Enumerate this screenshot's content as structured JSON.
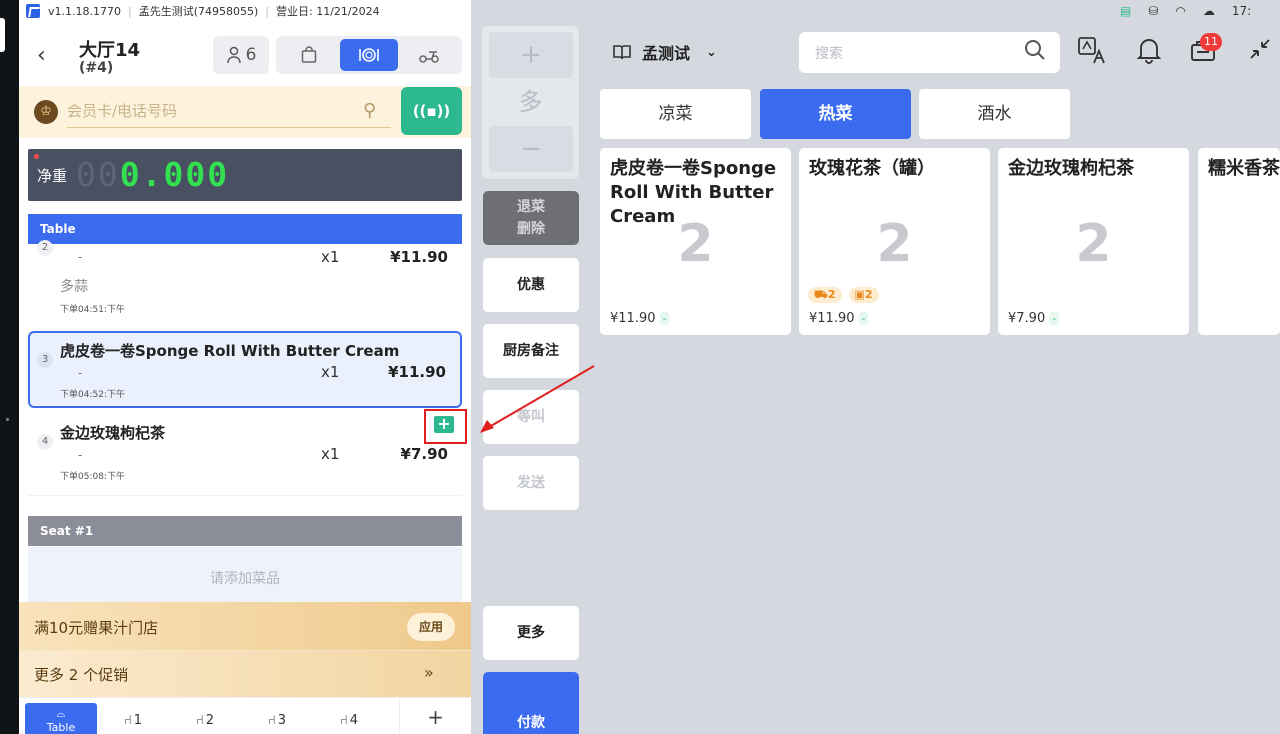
{
  "topbar": {
    "version": "v1.1.18.1770",
    "user": "孟先生测试(74958055)",
    "business_day": "营业日: 11/21/2024"
  },
  "status": {
    "time": "17:"
  },
  "header": {
    "table_name": "大厅14",
    "table_number": "(#4)",
    "guests": "6"
  },
  "member": {
    "placeholder": "会员卡/电话号码",
    "crest": "♔",
    "rfid": "((▪))"
  },
  "scale": {
    "label": "净重",
    "digits_off": "00",
    "digits_on": "0.000"
  },
  "sections": {
    "table": "Table",
    "seat": "Seat #1"
  },
  "order_items": [
    {
      "idx": "2",
      "name": "",
      "dash": "-",
      "qty": "x1",
      "price": "¥11.90",
      "note": "多蒜",
      "time": "下单04:51:下午"
    },
    {
      "idx": "3",
      "name": "虎皮卷一卷Sponge Roll With Butter Cream",
      "dash": "-",
      "qty": "x1",
      "price": "¥11.90",
      "time": "下单04:52:下午"
    },
    {
      "idx": "4",
      "name": "金边玫瑰枸杞茶",
      "dash": "-",
      "qty": "x1",
      "price": "¥7.90",
      "time": "下单05:08:下午"
    }
  ],
  "seat_empty": "请添加菜品",
  "promo": {
    "text": "满10元赠果汁门店",
    "apply": "应用",
    "more": "更多 2 个促销",
    "more_arrow": "»"
  },
  "seat_tabs": {
    "table": "Table",
    "s1": "1",
    "s2": "2",
    "s3": "3",
    "s4": "4",
    "add": "+"
  },
  "qty_box": {
    "plus": "+",
    "multi": "多",
    "minus": "−"
  },
  "actions": {
    "void1": "退菜",
    "void2": "删除",
    "discount": "优惠",
    "kitchen": "厨房备注",
    "hold": "等叫",
    "send": "发送",
    "more": "更多",
    "pay": "付款"
  },
  "store": {
    "name": "孟测试"
  },
  "search": {
    "placeholder": "搜索"
  },
  "badge": "11",
  "categories": [
    "凉菜",
    "热菜",
    "酒水"
  ],
  "products": [
    {
      "name": "虎皮卷一卷Sponge Roll With Butter Cream",
      "count": "2",
      "price": "¥11.90",
      "chip": "-"
    },
    {
      "name": "玫瑰花茶（罐）",
      "count": "2",
      "price": "¥11.90",
      "chip": "-",
      "tag1": "2",
      "tag2": "2"
    },
    {
      "name": "金边玫瑰枸杞茶",
      "count": "2",
      "price": "¥7.90",
      "chip": "-"
    },
    {
      "name": "糯米香茶",
      "count": "",
      "price": "",
      "chip": ""
    }
  ],
  "colors": {
    "primary": "#3b6cf0",
    "green": "#2db990",
    "annotation": "#e21f1f"
  }
}
